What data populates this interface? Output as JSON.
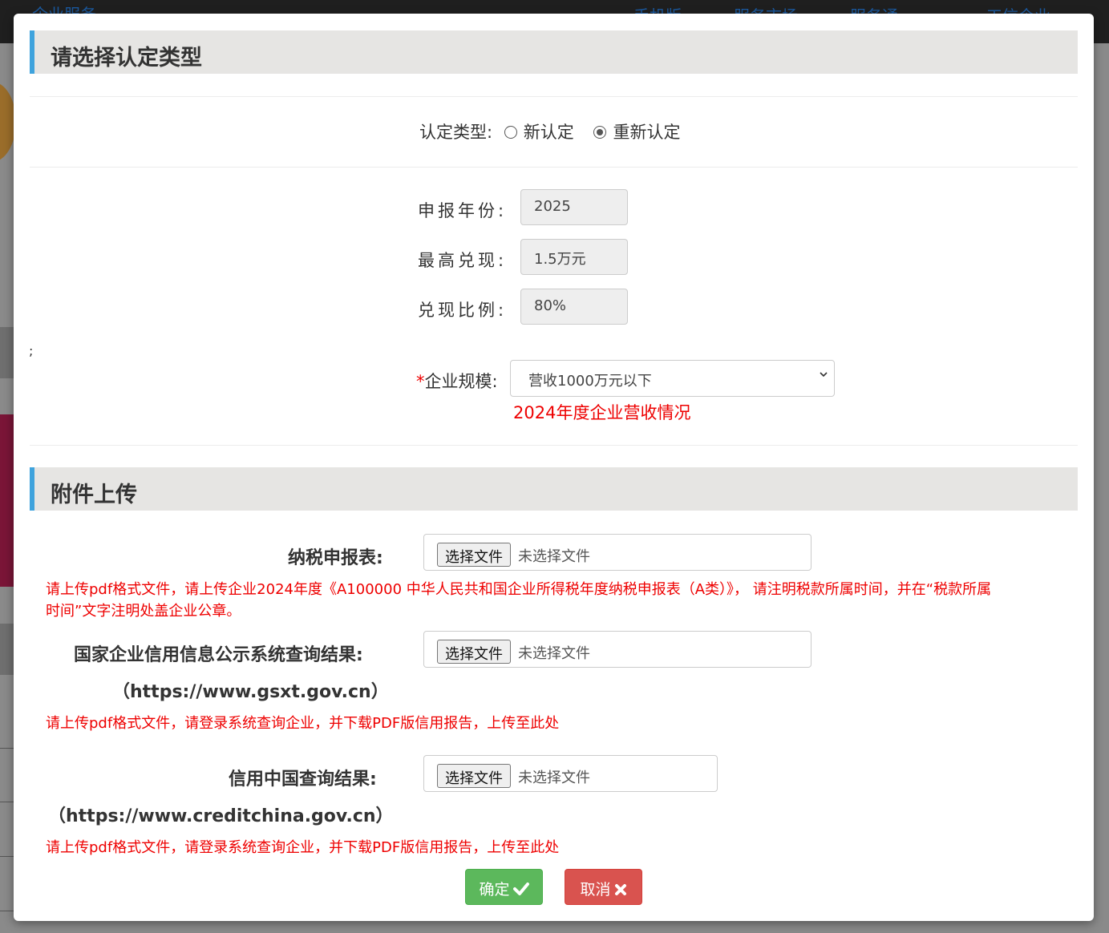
{
  "background": {
    "nav_items": [
      "企业服务",
      "手机版",
      "服务市场",
      "服务通",
      "工信企业"
    ]
  },
  "modal": {
    "section1_title": "请选择认定类型",
    "type_label": "认定类型:",
    "type_options": [
      {
        "label": "新认定",
        "checked": false
      },
      {
        "label": "重新认定",
        "checked": true
      }
    ],
    "year_label": "申报年份:",
    "year_value": "2025",
    "max_label": "最高兑现:",
    "max_value": "1.5万元",
    "ratio_label": "兑现比例:",
    "ratio_value": "80%",
    "scale_required_mark": "*",
    "scale_label": "企业规模:",
    "scale_selected": "营收1000万元以下",
    "scale_hint": "2024年度企业营收情况",
    "stray_text": ";",
    "section2_title": "附件上传",
    "uploads": [
      {
        "label": "纳税申报表:",
        "sub_label": "",
        "button": "选择文件",
        "status": "未选择文件",
        "note_line1": "请上传pdf格式文件，请上传企业2024年度《A100000 中华人民共和国企业所得税年度纳税申报表（A类）》， 请注明税款所属时间，并在“税款所属",
        "note_line2": "时间”文字注明处盖企业公章。"
      },
      {
        "label": "国家企业信用信息公示系统查询结果:",
        "sub_label": "（https://www.gsxt.gov.cn）",
        "button": "选择文件",
        "status": "未选择文件",
        "note_line1": "请上传pdf格式文件，请登录系统查询企业，并下载PDF版信用报告，上传至此处",
        "note_line2": ""
      },
      {
        "label": "信用中国查询结果:",
        "sub_label": "（https://www.creditchina.gov.cn）",
        "button": "选择文件",
        "status": "未选择文件",
        "note_line1": "请上传pdf格式文件，请登录系统查询企业，并下载PDF版信用报告，上传至此处",
        "note_line2": ""
      }
    ],
    "confirm_label": "确定",
    "cancel_label": "取消"
  },
  "colors": {
    "accent_bar": "#3fa3dd",
    "confirm": "#5cb85c",
    "cancel": "#d9534f",
    "hint": "#ee0000"
  }
}
